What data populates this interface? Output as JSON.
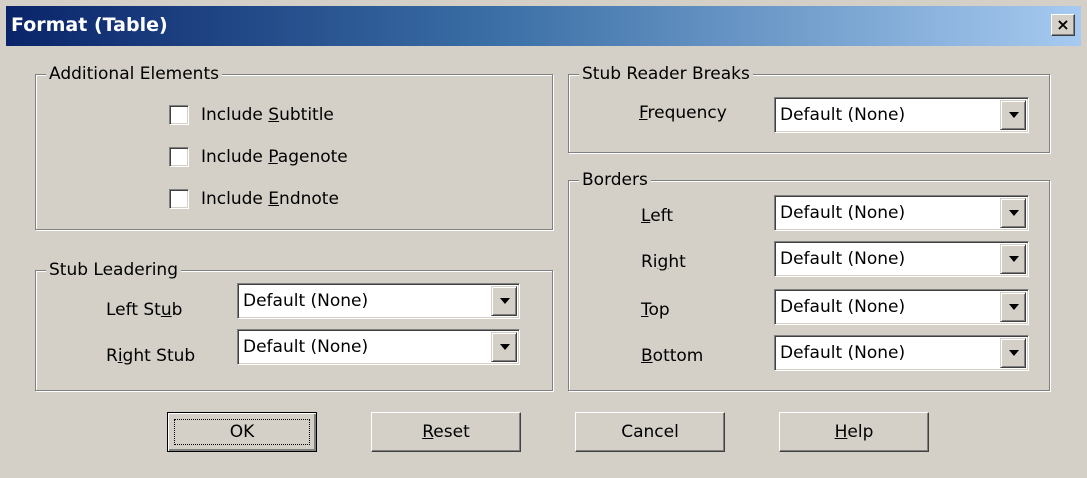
{
  "window": {
    "title": "Format (Table)",
    "close_glyph": "×"
  },
  "additional_elements": {
    "legend": "Additional Elements",
    "items": [
      {
        "pre": "Include ",
        "acc": "S",
        "post": "ubtitle",
        "checked": false
      },
      {
        "pre": "Include ",
        "acc": "P",
        "post": "agenote",
        "checked": false
      },
      {
        "pre": "Include ",
        "acc": "E",
        "post": "ndnote",
        "checked": false
      }
    ]
  },
  "stub_leadering": {
    "legend": "Stub Leadering",
    "rows": [
      {
        "pre": "Left St",
        "acc": "u",
        "post": "b",
        "value": "Default (None)"
      },
      {
        "pre": "R",
        "acc": "i",
        "post": "ght Stub",
        "value": "Default (None)"
      }
    ]
  },
  "stub_reader_breaks": {
    "legend": "Stub Reader Breaks",
    "frequency": {
      "pre": "",
      "acc": "F",
      "post": "requency",
      "value": "Default  (None)"
    }
  },
  "borders": {
    "legend": "Borders",
    "rows": [
      {
        "pre": "",
        "acc": "L",
        "post": "eft",
        "value": "Default (None)"
      },
      {
        "pre": "Ri",
        "acc": "g",
        "post": "ht",
        "value": "Default (None)"
      },
      {
        "pre": "",
        "acc": "T",
        "post": "op",
        "value": "Default (None)"
      },
      {
        "pre": "",
        "acc": "B",
        "post": "ottom",
        "value": "Default (None)"
      }
    ]
  },
  "buttons": {
    "ok": {
      "pre": "OK",
      "acc": "",
      "post": ""
    },
    "reset": {
      "pre": "",
      "acc": "R",
      "post": "eset"
    },
    "cancel": {
      "pre": "Cancel",
      "acc": "",
      "post": ""
    },
    "help": {
      "pre": "",
      "acc": "H",
      "post": "elp"
    }
  }
}
